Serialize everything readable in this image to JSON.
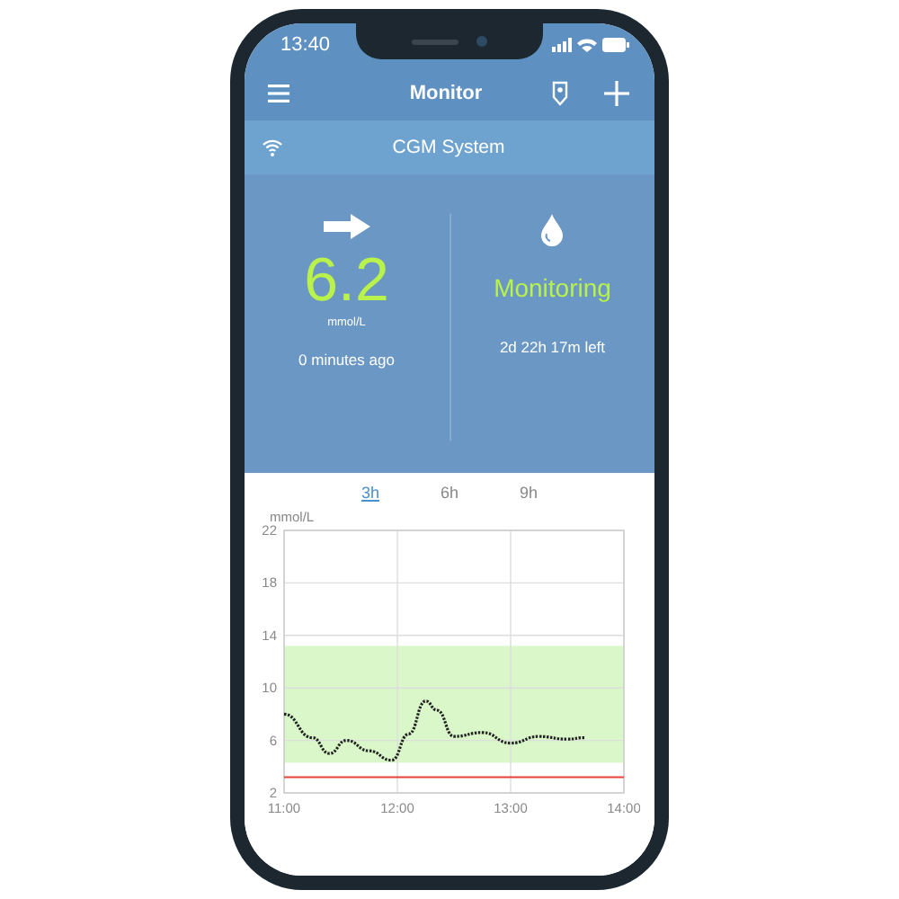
{
  "status_bar": {
    "time": "13:40"
  },
  "header": {
    "title": "Monitor"
  },
  "device_bar": {
    "label": "CGM System"
  },
  "reading": {
    "value": "6.2",
    "unit": "mmol/L",
    "age": "0 minutes ago"
  },
  "sensor": {
    "status": "Monitoring",
    "remaining": "2d 22h 17m left"
  },
  "range_tabs": [
    {
      "label": "3h",
      "selected": true
    },
    {
      "label": "6h",
      "selected": false
    },
    {
      "label": "9h",
      "selected": false
    }
  ],
  "chart": {
    "chart_data": {
      "type": "line",
      "ylabel": "mmol/L",
      "x": [
        11,
        11.25,
        11.4,
        11.55,
        11.75,
        11.95,
        12.1,
        12.25,
        12.35,
        12.5,
        12.75,
        13,
        13.25,
        13.5,
        13.65
      ],
      "series": [
        {
          "color": "#222222",
          "line_style": "dotted",
          "values": [
            8,
            6.2,
            5,
            6,
            5.2,
            4.5,
            6.5,
            9,
            8.3,
            6.3,
            6.6,
            5.8,
            6.3,
            6.1,
            6.2
          ]
        }
      ],
      "xlim": [
        11,
        14
      ],
      "ylim": [
        2,
        22
      ],
      "xticks": [
        {
          "value": 11,
          "label": "11:00"
        },
        {
          "value": 12,
          "label": "12:00"
        },
        {
          "value": 13,
          "label": "13:00"
        },
        {
          "value": 14,
          "label": "14:00"
        }
      ],
      "yticks": [
        2,
        6,
        10,
        14,
        18,
        22
      ],
      "grid": true,
      "bands": [
        {
          "axis": "y",
          "from": 4.3,
          "to": 13.2,
          "color": "#d9f7c9"
        }
      ],
      "ref_lines": [
        {
          "axis": "y",
          "value": 3.2,
          "color": "#e8413a"
        }
      ]
    }
  }
}
